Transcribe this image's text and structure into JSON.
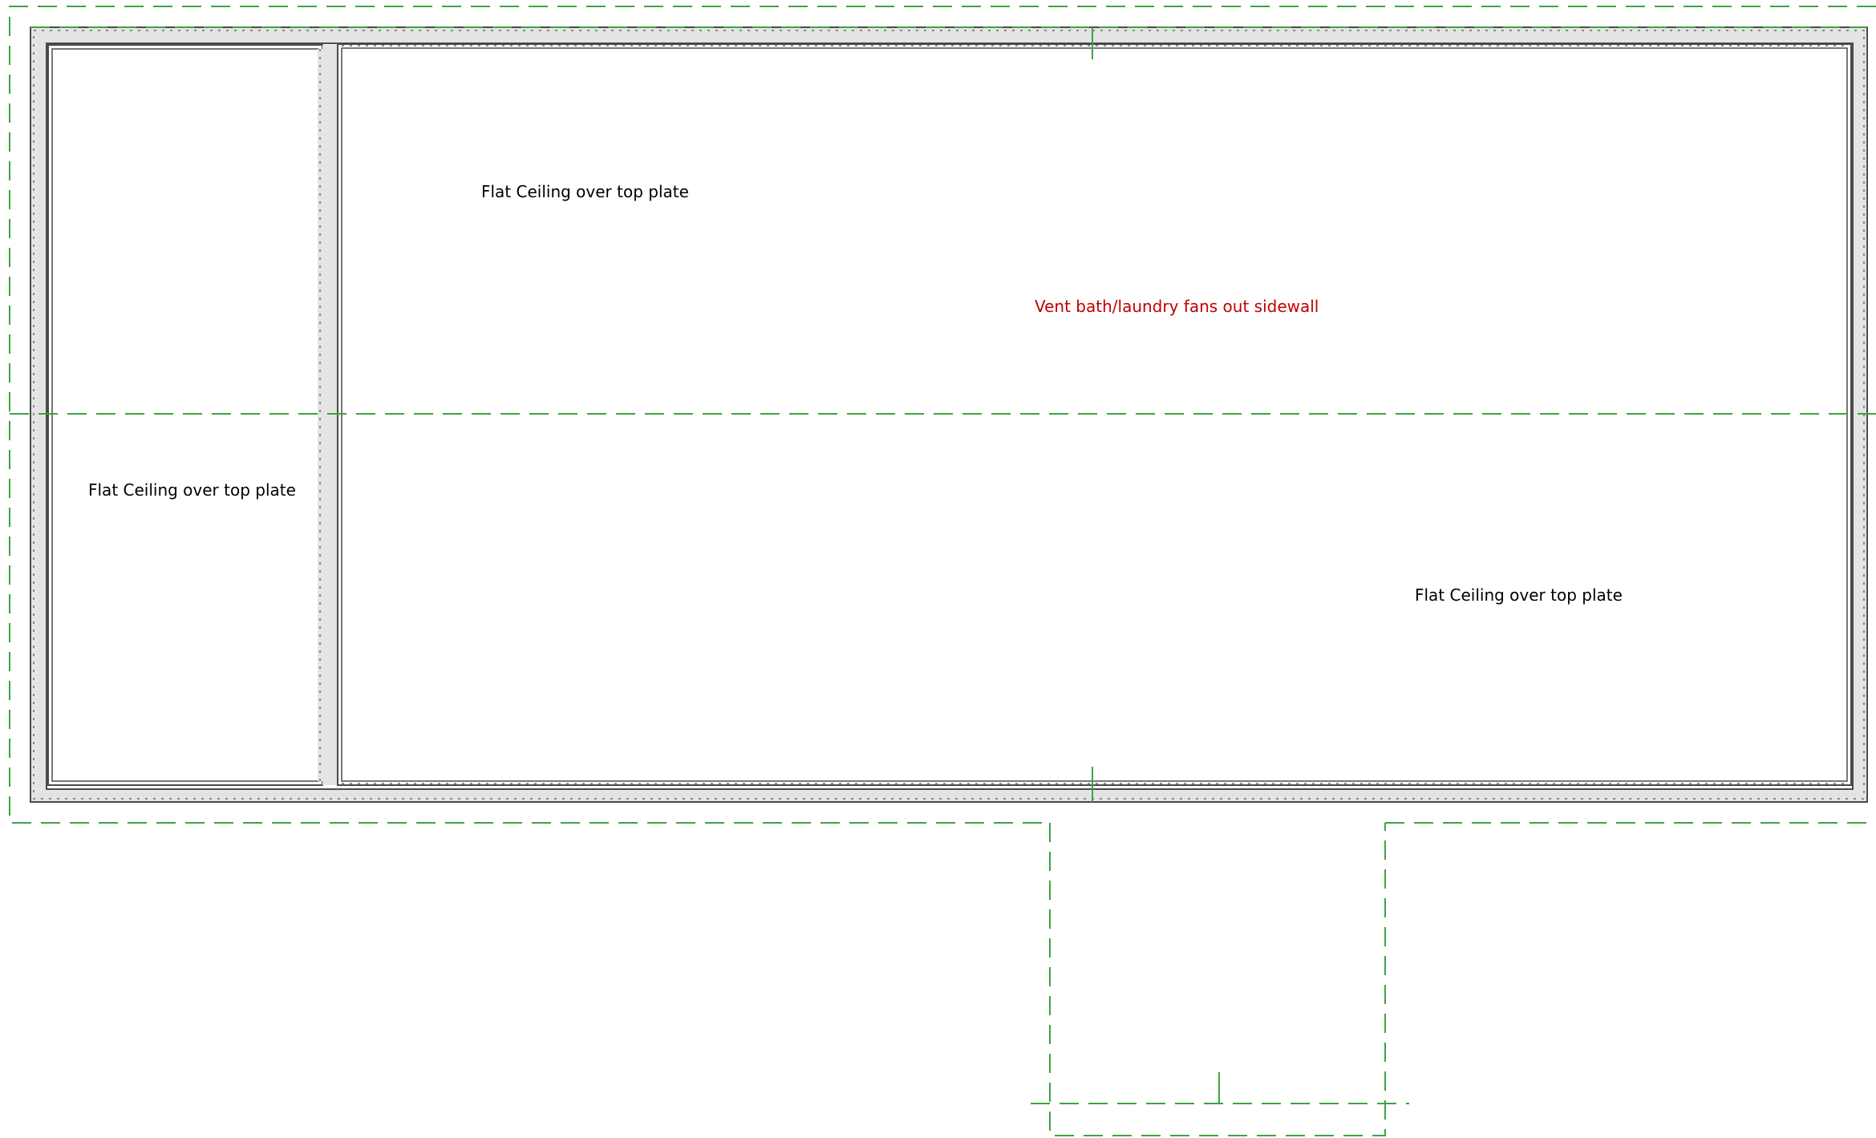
{
  "labels": {
    "flat_ceiling_upper_left": "Flat Ceiling over top plate",
    "flat_ceiling_left_room": "Flat Ceiling over top plate",
    "flat_ceiling_lower_right": "Flat Ceiling over top plate",
    "vent_note": "Vent bath/laundry fans out sidewall"
  },
  "colors": {
    "wall_line": "#4a4a4a",
    "wall_fill": "#e4e4e4",
    "dashed_outline": "#3fa33f",
    "text": "#000000",
    "note_text": "#c00000",
    "background": "#ffffff"
  }
}
